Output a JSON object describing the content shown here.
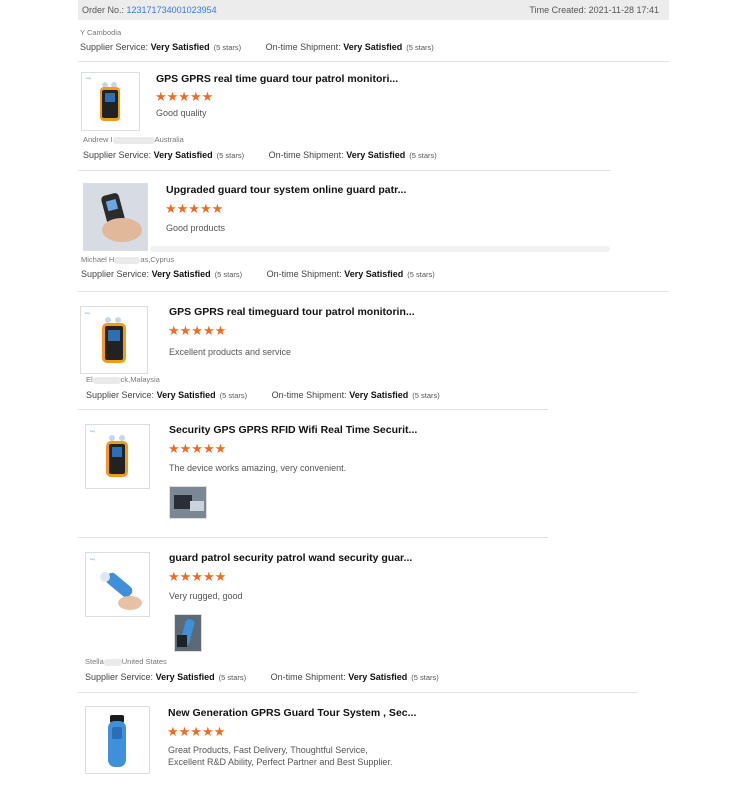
{
  "header": {
    "order_label": "Order No.:",
    "order_number": "123171734001023954",
    "time_created": "Time Created: 2021-11-28 17:41"
  },
  "service_labels": {
    "supplier": "Supplier Service:",
    "shipment": "On-time Shipment:",
    "rating": "Very Satisfied",
    "stars_text": "(5 stars)"
  },
  "first_buyer": "Y        Cambodia",
  "reviews": [
    {
      "title": "GPS GPRS real time guard tour patrol monitori...",
      "stars": "★★★★★",
      "comment": "Good quality",
      "buyer": "Andrew I",
      "buyer_country": "Australia"
    },
    {
      "title": "Upgraded guard tour system online guard patr...",
      "stars": "★★★★★",
      "comment": "Good products",
      "buyer": "Michael H",
      "buyer_country": "as,Cyprus"
    },
    {
      "title": "GPS GPRS real timeguard tour patrol monitorin...",
      "stars": "★★★★★",
      "comment": "Excellent products and service",
      "buyer": "El",
      "buyer_country": "ck,Malaysia"
    },
    {
      "title": "Security GPS GPRS RFID Wifi Real Time Securit...",
      "stars": "★★★★★",
      "comment": "The device works amazing, very convenient."
    },
    {
      "title": "guard patrol security patrol wand security guar...",
      "stars": "★★★★★",
      "comment": "Very rugged, good",
      "buyer": "Stella",
      "buyer_country": "United States"
    },
    {
      "title": "New Generation GPRS Guard Tour System , Sec...",
      "stars": "★★★★★",
      "comment_line1": "Great Products, Fast Delivery, Thoughtful Service,",
      "comment_line2": "Excellent R&D Ability, Perfect Partner and Best Supplier."
    }
  ],
  "colors": {
    "star": "#f06b22",
    "link": "#3a7bd5",
    "topbar_bg": "#ececec",
    "device_orange": "#f29a1c",
    "device_blue": "#3f8fd9"
  },
  "icons": {
    "star": "star-icon",
    "device": "patrol-device-icon"
  }
}
